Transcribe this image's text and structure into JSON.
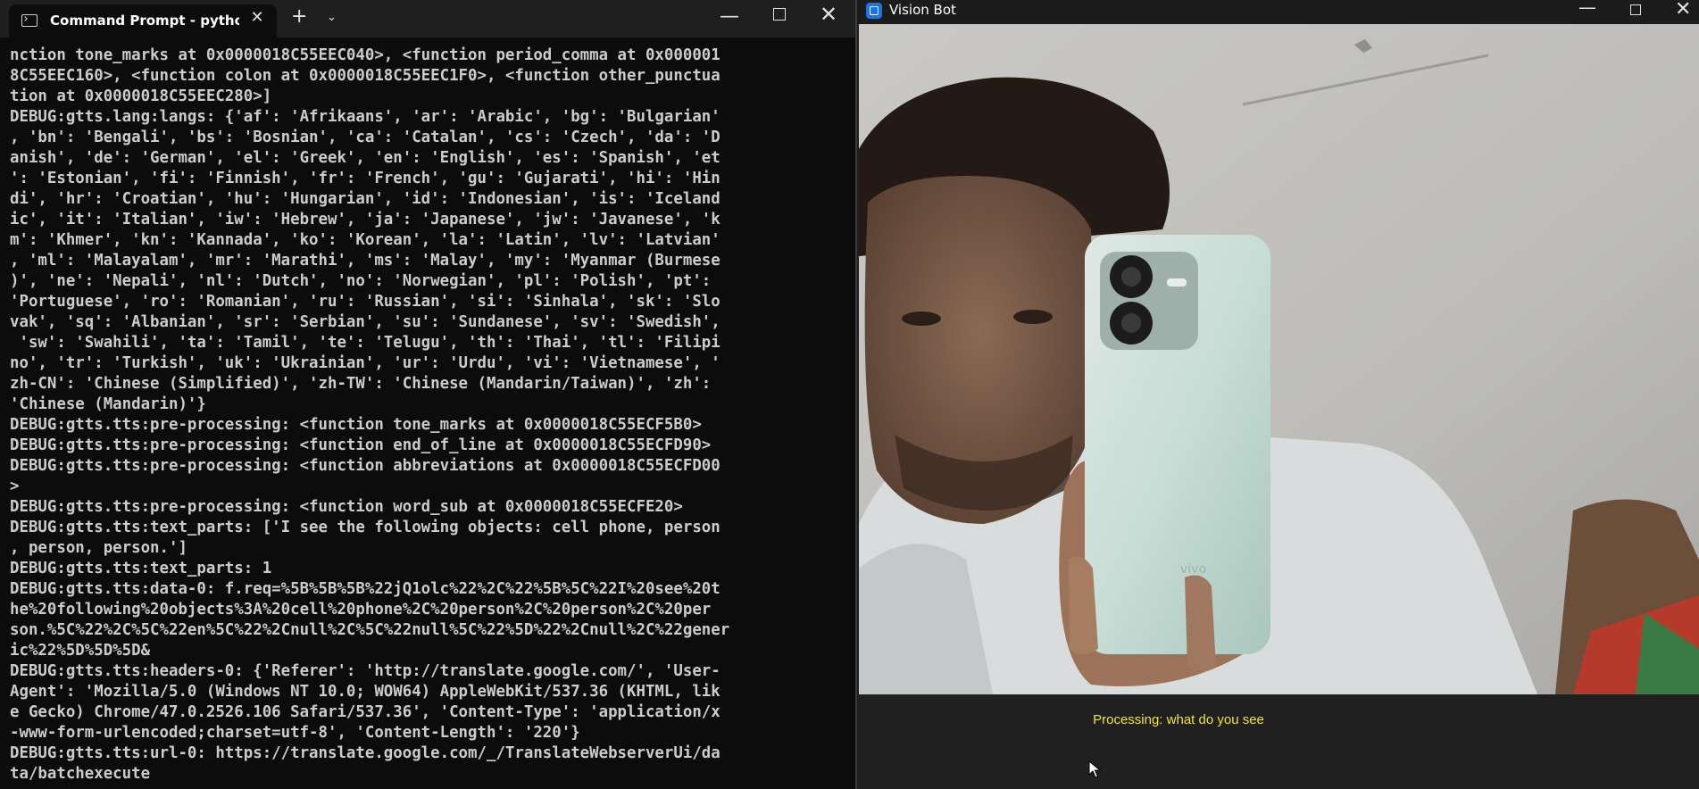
{
  "terminal": {
    "tab_title": "Command Prompt - python a",
    "tab_close_glyph": "✕",
    "new_tab_glyph": "+",
    "dropdown_glyph": "⌄",
    "min_glyph": "—",
    "close_glyph": "✕",
    "output": "nction tone_marks at 0x0000018C55EEC040>, <function period_comma at 0x000001\n8C55EEC160>, <function colon at 0x0000018C55EEC1F0>, <function other_punctua\ntion at 0x0000018C55EEC280>]\nDEBUG:gtts.lang:langs: {'af': 'Afrikaans', 'ar': 'Arabic', 'bg': 'Bulgarian'\n, 'bn': 'Bengali', 'bs': 'Bosnian', 'ca': 'Catalan', 'cs': 'Czech', 'da': 'D\nanish', 'de': 'German', 'el': 'Greek', 'en': 'English', 'es': 'Spanish', 'et\n': 'Estonian', 'fi': 'Finnish', 'fr': 'French', 'gu': 'Gujarati', 'hi': 'Hin\ndi', 'hr': 'Croatian', 'hu': 'Hungarian', 'id': 'Indonesian', 'is': 'Iceland\nic', 'it': 'Italian', 'iw': 'Hebrew', 'ja': 'Japanese', 'jw': 'Javanese', 'k\nm': 'Khmer', 'kn': 'Kannada', 'ko': 'Korean', 'la': 'Latin', 'lv': 'Latvian'\n, 'ml': 'Malayalam', 'mr': 'Marathi', 'ms': 'Malay', 'my': 'Myanmar (Burmese\n)', 'ne': 'Nepali', 'nl': 'Dutch', 'no': 'Norwegian', 'pl': 'Polish', 'pt':\n'Portuguese', 'ro': 'Romanian', 'ru': 'Russian', 'si': 'Sinhala', 'sk': 'Slo\nvak', 'sq': 'Albanian', 'sr': 'Serbian', 'su': 'Sundanese', 'sv': 'Swedish',\n 'sw': 'Swahili', 'ta': 'Tamil', 'te': 'Telugu', 'th': 'Thai', 'tl': 'Filipi\nno', 'tr': 'Turkish', 'uk': 'Ukrainian', 'ur': 'Urdu', 'vi': 'Vietnamese', '\nzh-CN': 'Chinese (Simplified)', 'zh-TW': 'Chinese (Mandarin/Taiwan)', 'zh':\n'Chinese (Mandarin)'}\nDEBUG:gtts.tts:pre-processing: <function tone_marks at 0x0000018C55ECF5B0>\nDEBUG:gtts.tts:pre-processing: <function end_of_line at 0x0000018C55ECFD90>\nDEBUG:gtts.tts:pre-processing: <function abbreviations at 0x0000018C55ECFD00\n>\nDEBUG:gtts.tts:pre-processing: <function word_sub at 0x0000018C55ECFE20>\nDEBUG:gtts.tts:text_parts: ['I see the following objects: cell phone, person\n, person, person.']\nDEBUG:gtts.tts:text_parts: 1\nDEBUG:gtts.tts:data-0: f.req=%5B%5B%5B%22jQ1olc%22%2C%22%5B%5C%22I%20see%20t\nhe%20following%20objects%3A%20cell%20phone%2C%20person%2C%20person%2C%20per\nson.%5C%22%2C%5C%22en%5C%22%2Cnull%2C%5C%22null%5C%22%5D%22%2Cnull%2C%22gener\nic%22%5D%5D%5D&\nDEBUG:gtts.tts:headers-0: {'Referer': 'http://translate.google.com/', 'User-\nAgent': 'Mozilla/5.0 (Windows NT 10.0; WOW64) AppleWebKit/537.36 (KHTML, lik\ne Gecko) Chrome/47.0.2526.106 Safari/537.36', 'Content-Type': 'application/x\n-www-form-urlencoded;charset=utf-8', 'Content-Length': '220'}\nDEBUG:gtts.tts:url-0: https://translate.google.com/_/TranslateWebserverUi/da\nta/batchexecute"
  },
  "visionbot": {
    "title": "Vision Bot",
    "min_glyph": "—",
    "close_glyph": "✕",
    "status": "Processing: what do you see"
  },
  "colors": {
    "terminal_bg": "#0c0c0c",
    "terminal_text": "#cccccc",
    "status_text": "#f2e234",
    "app_icon": "#1a73e8"
  },
  "icons": [
    "terminal-icon",
    "close-icon",
    "plus-icon",
    "chevron-down-icon",
    "minimize-icon",
    "maximize-icon",
    "app-icon",
    "mouse-pointer-icon"
  ]
}
